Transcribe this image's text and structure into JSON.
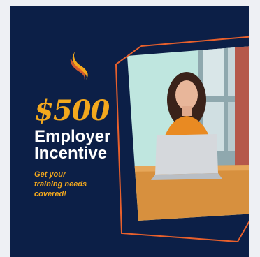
{
  "promo": {
    "amount": "$500",
    "headline_line1": "Employer",
    "headline_line2": "Incentive",
    "tagline_line1": "Get your",
    "tagline_line2": "training needs",
    "tagline_line3": "covered!"
  },
  "colors": {
    "background": "#0c1f47",
    "accent": "#f3a81d",
    "text": "#ffffff"
  },
  "icons": [
    "brand-swoosh-logo",
    "photo-frame"
  ]
}
